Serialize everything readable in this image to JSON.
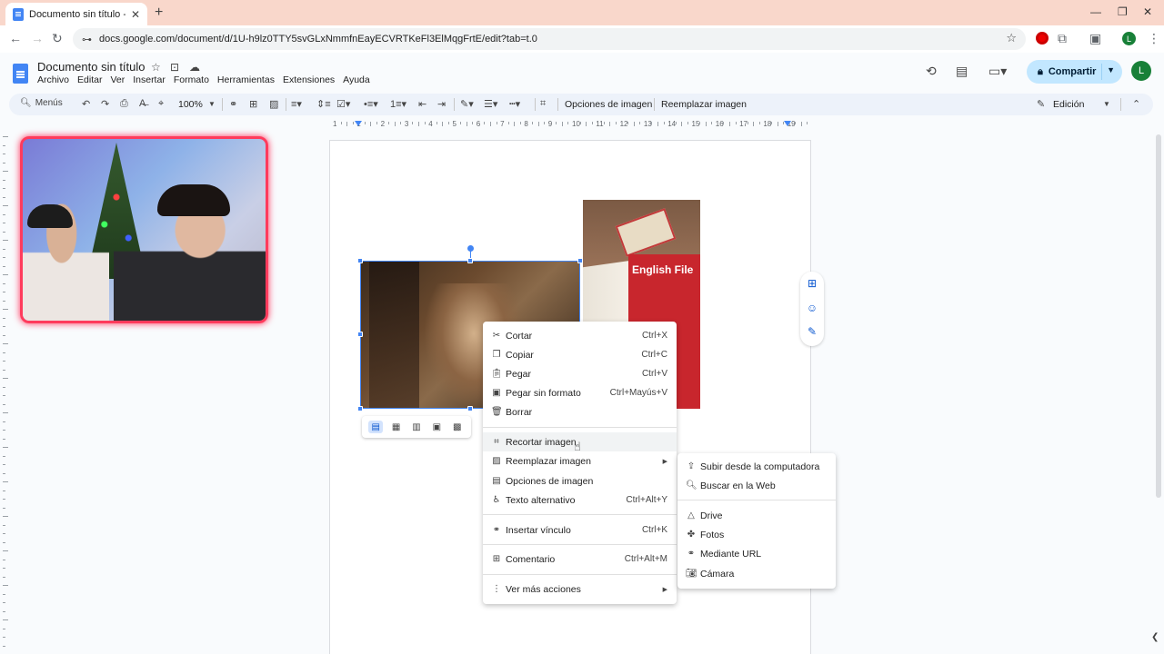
{
  "browser": {
    "tab_title": "Documento sin título - Docume",
    "new_tab_icon": "plus-icon",
    "url": "docs.google.com/document/d/1U-h9lz0TTY5svGLxNmmfnEayECVRTKeFl3ElMqgFrtE/edit?tab=t.0",
    "profile_initial": "L"
  },
  "docs": {
    "title": "Documento sin título",
    "menus": [
      "Archivo",
      "Editar",
      "Ver",
      "Insertar",
      "Formato",
      "Herramientas",
      "Extensiones",
      "Ayuda"
    ],
    "share_label": "Compartir",
    "avatar_initial": "L"
  },
  "toolbar": {
    "search_label": "Menús",
    "zoom": "100%",
    "image_options": "Opciones de imagen",
    "replace_image": "Reemplazar imagen",
    "mode": "Edición"
  },
  "ruler": {
    "numbers": [
      "1",
      "1",
      "2",
      "3",
      "4",
      "5",
      "6",
      "7",
      "8",
      "9",
      "10",
      "11",
      "12",
      "13",
      "14",
      "15",
      "16",
      "17",
      "18",
      "19"
    ]
  },
  "book_cover_text": "English File",
  "context_menu": {
    "items": [
      {
        "icon": "scissors-icon",
        "label": "Cortar",
        "shortcut": "Ctrl+X"
      },
      {
        "icon": "copy-icon",
        "label": "Copiar",
        "shortcut": "Ctrl+C"
      },
      {
        "icon": "paste-icon",
        "label": "Pegar",
        "shortcut": "Ctrl+V"
      },
      {
        "icon": "paste-plain-icon",
        "label": "Pegar sin formato",
        "shortcut": "Ctrl+Mayús+V"
      },
      {
        "icon": "trash-icon",
        "label": "Borrar",
        "shortcut": ""
      },
      {
        "icon": "crop-icon",
        "label": "Recortar imagen",
        "shortcut": ""
      },
      {
        "icon": "image-icon",
        "label": "Reemplazar imagen",
        "shortcut": ""
      },
      {
        "icon": "image-options-icon",
        "label": "Opciones de imagen",
        "shortcut": ""
      },
      {
        "icon": "accessibility-icon",
        "label": "Texto alternativo",
        "shortcut": "Ctrl+Alt+Y"
      },
      {
        "icon": "link-icon",
        "label": "Insertar vínculo",
        "shortcut": "Ctrl+K"
      },
      {
        "icon": "comment-icon",
        "label": "Comentario",
        "shortcut": "Ctrl+Alt+M"
      },
      {
        "icon": "more-vert-icon",
        "label": "Ver más acciones",
        "shortcut": ""
      }
    ]
  },
  "submenu": {
    "items": [
      {
        "icon": "upload-icon",
        "label": "Subir desde la computadora"
      },
      {
        "icon": "search-icon",
        "label": "Buscar en la Web"
      },
      {
        "icon": "drive-icon",
        "label": "Drive"
      },
      {
        "icon": "photos-icon",
        "label": "Fotos"
      },
      {
        "icon": "link-icon",
        "label": "Mediante URL"
      },
      {
        "icon": "camera-icon",
        "label": "Cámara"
      }
    ]
  }
}
